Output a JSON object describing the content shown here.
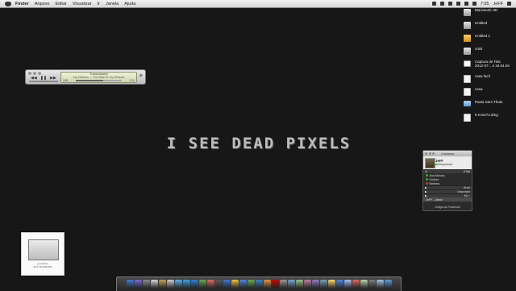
{
  "menubar": {
    "items": [
      "Finder",
      "Arquivo",
      "Editar",
      "Visualizar",
      "Ir",
      "Janela",
      "Ajuda"
    ],
    "time": "7:05",
    "user": "JeFF"
  },
  "desktop_icons": [
    {
      "label": "Macintosh HD",
      "icon": "hard-drive-icon",
      "kind": "hd"
    },
    {
      "label": "Untitled",
      "icon": "hard-drive-icon",
      "kind": "hd"
    },
    {
      "label": "Untitled 1",
      "icon": "usb-drive-icon",
      "kind": "usb"
    },
    {
      "label": "USB",
      "icon": "hard-drive-icon",
      "kind": "hd"
    },
    {
      "label": "Captura de Tela\n2012-07-...s 19.04.59",
      "icon": "screenshot-icon",
      "kind": "shot"
    },
    {
      "label": "casa facil",
      "icon": "document-icon",
      "kind": "doc"
    },
    {
      "label": "casa",
      "icon": "document-icon",
      "kind": "doc"
    },
    {
      "label": "Pasta Sem Título",
      "icon": "folder-icon",
      "kind": "folder"
    },
    {
      "label": "h-mi1073.dmg",
      "icon": "disk-image-icon",
      "kind": "doc"
    }
  ],
  "itunes": {
    "title": "Transmission",
    "track": "Joy Division — The Best Of Joy Division",
    "elapsed": "0:59",
    "remaining": "-2:14",
    "progress": 0.6
  },
  "wallpaper_text": "I SEE DEAD PIXELS",
  "contacts": {
    "title": "Contatos",
    "me_name": "JeFF",
    "me_status": "Disponível",
    "group_top": "GTalk",
    "items": [
      {
        "name": "Ana Mônica",
        "color": "#2ea52e"
      },
      {
        "name": "Guilher",
        "color": "#2ea52e"
      },
      {
        "name": "Barbara",
        "color": "#c0392b"
      }
    ],
    "groups": [
      "Bruni",
      "Desconect",
      "MJ +"
    ],
    "selected": "JeFF - Jamie",
    "footer": "Amigos do Facebook"
  },
  "album": {
    "artist_small": "joy division",
    "title": "JOY DIVISION"
  },
  "dock_colors": [
    "#3d7fd8",
    "#7b6bd6",
    "#8b8b8b",
    "#d8d8d8",
    "#c2a25b",
    "#cfcfcf",
    "#5ab0e6",
    "#3b9fdf",
    "#2f7fd4",
    "#6aa84f",
    "#e06666",
    "#5c5c5c",
    "#3c78d8",
    "#f1c232",
    "#4a86e8",
    "#6aa84f",
    "#3d85c6",
    "#e69138",
    "#cc0000",
    "#999999",
    "#6fa8dc",
    "#93c47d",
    "#c27ba0",
    "#8e7cc3",
    "#76a5af",
    "#ffd966",
    "#4a86e8",
    "#a4c2f4",
    "#e06666",
    "#b6d7a8",
    "#7f7f7f",
    "#9fc5e8",
    "#5b9bd5"
  ]
}
